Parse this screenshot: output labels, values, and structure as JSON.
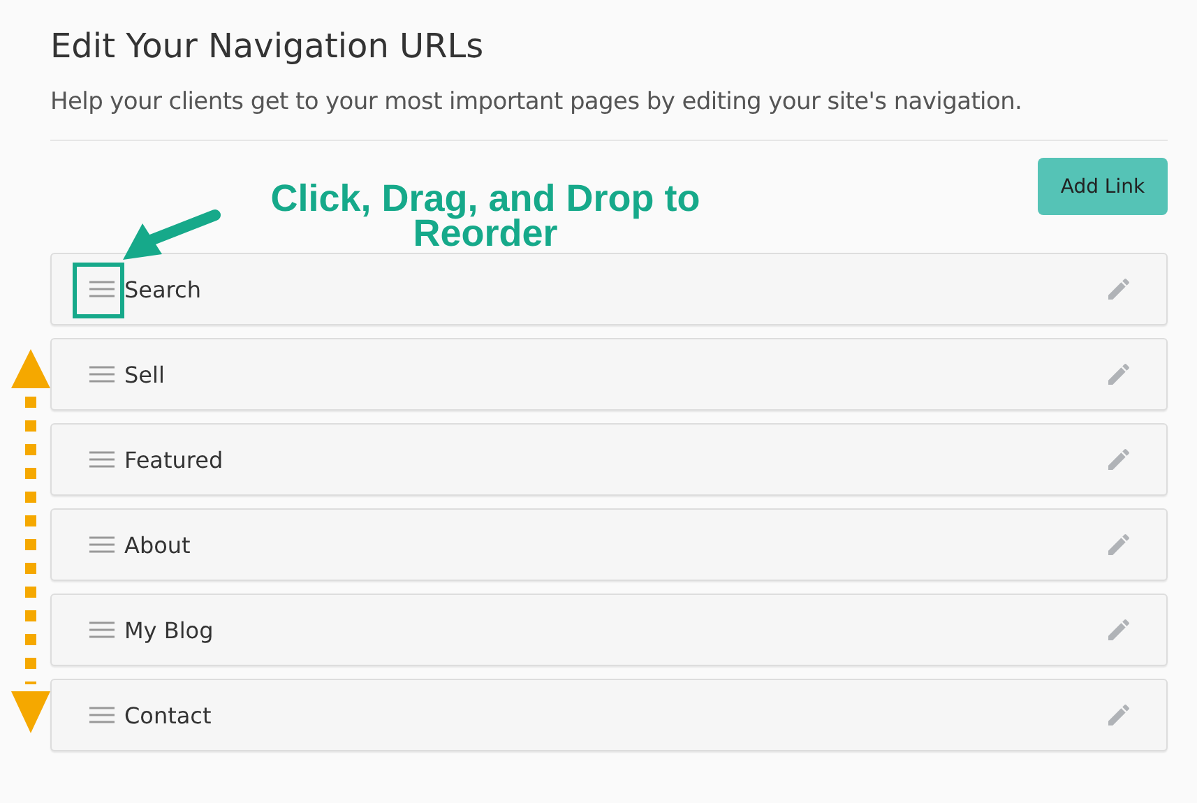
{
  "title": "Edit Your Navigation URLs",
  "subtitle": "Help your clients get to your most important pages by editing your site's navigation.",
  "add_button": "Add Link",
  "items": [
    {
      "label": "Search",
      "highlighted": true
    },
    {
      "label": "Sell",
      "highlighted": false
    },
    {
      "label": "Featured",
      "highlighted": false
    },
    {
      "label": "About",
      "highlighted": false
    },
    {
      "label": "My Blog",
      "highlighted": false
    },
    {
      "label": "Contact",
      "highlighted": false
    }
  ],
  "annotation": {
    "text": "Click, Drag, and Drop to Reorder"
  }
}
